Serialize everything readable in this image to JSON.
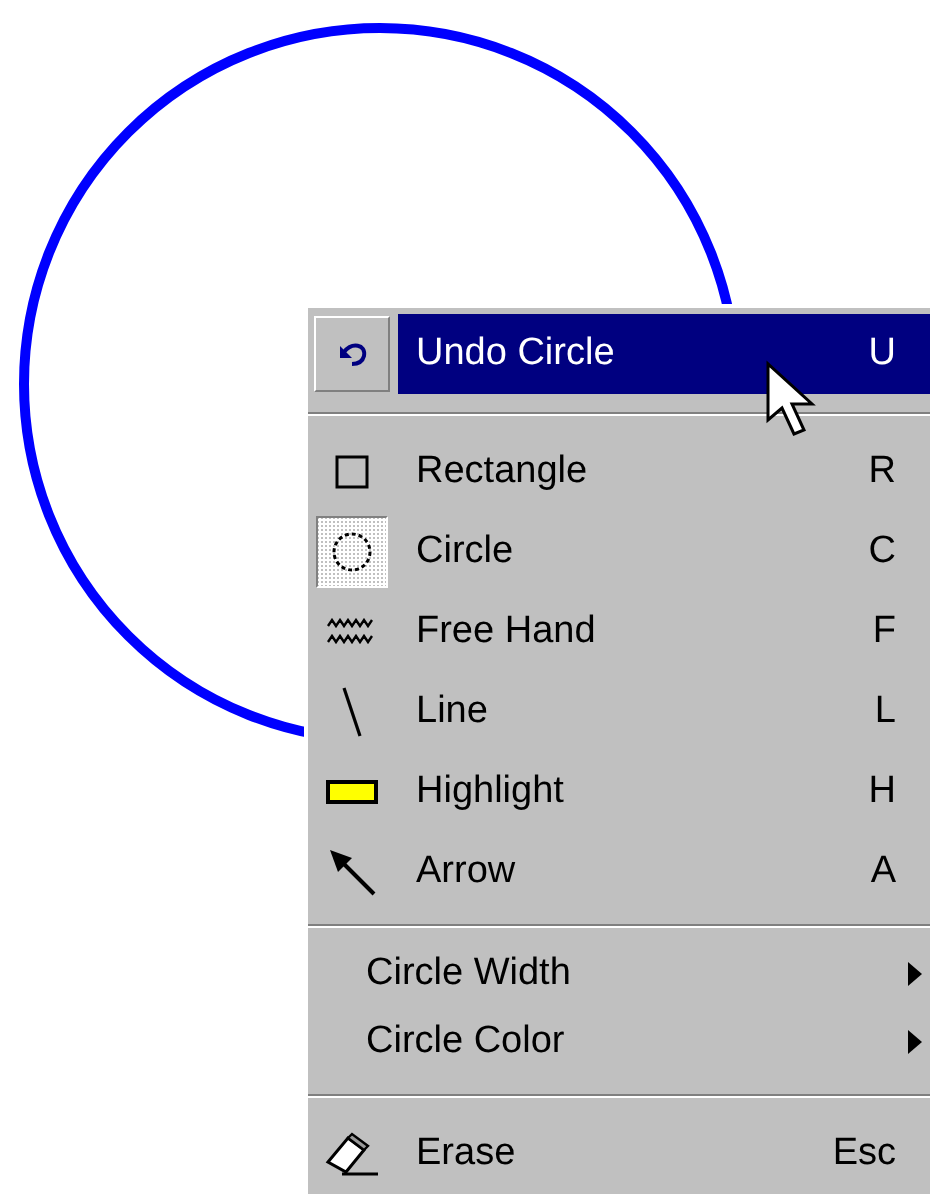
{
  "menu": {
    "items": [
      {
        "kind": "command",
        "label": "Undo Circle",
        "shortcut": "U",
        "selected": true,
        "checked": false
      },
      {
        "kind": "separator"
      },
      {
        "kind": "command",
        "label": "Rectangle",
        "shortcut": "R",
        "selected": false,
        "checked": false
      },
      {
        "kind": "command",
        "label": "Circle",
        "shortcut": "C",
        "selected": false,
        "checked": true
      },
      {
        "kind": "command",
        "label": "Free Hand",
        "shortcut": "F",
        "selected": false,
        "checked": false
      },
      {
        "kind": "command",
        "label": "Line",
        "shortcut": "L",
        "selected": false,
        "checked": false
      },
      {
        "kind": "command",
        "label": "Highlight",
        "shortcut": "H",
        "selected": false,
        "checked": false
      },
      {
        "kind": "command",
        "label": "Arrow",
        "shortcut": "A",
        "selected": false,
        "checked": false
      },
      {
        "kind": "separator"
      },
      {
        "kind": "submenu",
        "label": "Circle Width"
      },
      {
        "kind": "submenu",
        "label": "Circle Color"
      },
      {
        "kind": "separator"
      },
      {
        "kind": "command",
        "label": "Erase",
        "shortcut": "Esc",
        "selected": false,
        "checked": false
      }
    ]
  }
}
